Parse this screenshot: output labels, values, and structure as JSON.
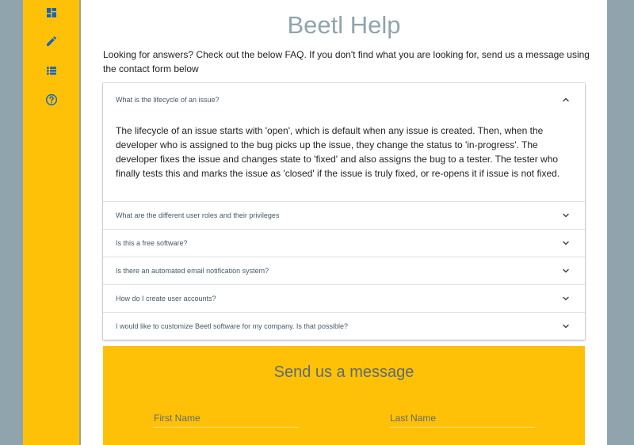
{
  "colors": {
    "accent": "#ffc107",
    "page_bg": "#90a4ae",
    "icon": "#1565c0"
  },
  "sidebar": {
    "icons": [
      "dashboard-icon",
      "edit-icon",
      "list-icon",
      "help-icon"
    ]
  },
  "main": {
    "title": "Beetl Help",
    "intro": "Looking for answers? Check out the below FAQ. If you don't find what you are looking for, send us a message using the contact form below"
  },
  "faq": {
    "items": [
      {
        "question": "What is the lifecycle of an issue?",
        "expanded": true,
        "answer": "The lifecycle of an issue starts with 'open', which is default when any issue is created. Then, when the developer who is assigned to the bug picks up the issue, they change the status to 'in-progress'. The developer fixes the issue and changes state to 'fixed' and also assigns the bug to a tester. The tester who finally tests this and marks the issue as 'closed' if the issue is truly fixed, or re-opens it if issue is not fixed."
      },
      {
        "question": "What are the different user roles and their privileges",
        "expanded": false
      },
      {
        "question": "Is this a free software?",
        "expanded": false
      },
      {
        "question": "Is there an automated email notification system?",
        "expanded": false
      },
      {
        "question": "How do I create user accounts?",
        "expanded": false
      },
      {
        "question": "I would like to customize Beetl software for my company. Is that possible?",
        "expanded": false
      }
    ]
  },
  "contact": {
    "title": "Send us a message",
    "first_name_label": "First Name",
    "last_name_label": "Last Name"
  }
}
